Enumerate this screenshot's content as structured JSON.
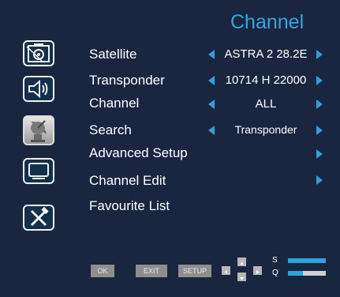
{
  "header": {
    "title": "Channel"
  },
  "sidebar": {
    "items": [
      {
        "icon": "photo-camera-icon",
        "active": false
      },
      {
        "icon": "speaker-volume-icon",
        "active": false
      },
      {
        "icon": "satellite-dish-icon",
        "active": true
      },
      {
        "icon": "monitor-icon",
        "active": false
      },
      {
        "icon": "tools-icon",
        "active": false
      }
    ]
  },
  "menu": {
    "items": [
      {
        "label": "Satellite",
        "value": "ASTRA 2 28.2E"
      },
      {
        "label": "Transponder",
        "value": "10714 H 22000"
      },
      {
        "label": "Channel",
        "value": "ALL"
      },
      {
        "label": "Search",
        "value": "Transponder"
      },
      {
        "label": "Advanced Setup"
      },
      {
        "label": "Channel Edit"
      },
      {
        "label": "Favourite List"
      }
    ]
  },
  "footer": {
    "ok_label": "OK",
    "exit_label": "EXIT",
    "setup_label": "SETUP",
    "signal_label": "S",
    "quality_label": "Q",
    "signal_strength": 1.0,
    "signal_quality": 0.4
  },
  "colors": {
    "background": "#1a2540",
    "accent": "#2fa8e0",
    "button": "#8e8e8e"
  }
}
